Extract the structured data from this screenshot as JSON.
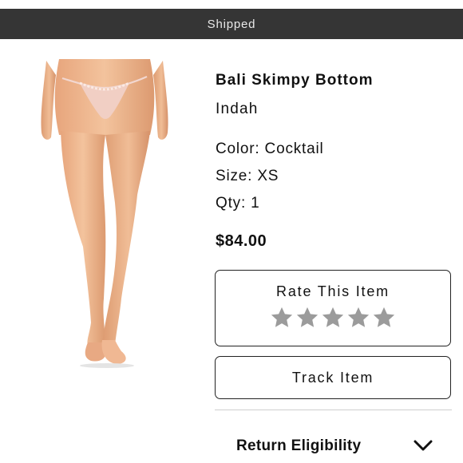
{
  "status_bar": {
    "label": "Shipped"
  },
  "product": {
    "name": "Bali Skimpy Bottom",
    "brand": "Indah",
    "color": "Color: Cocktail",
    "size": "Size: XS",
    "quantity": "Qty: 1",
    "price": "$84.00",
    "image_icon": "product-photo"
  },
  "rating": {
    "title": "Rate This Item",
    "star_count": 5,
    "selected": 0,
    "star_icon": "star-icon",
    "star_color": "#9b9b9b"
  },
  "actions": {
    "track_label": "Track Item"
  },
  "return_section": {
    "label": "Return Eligibility",
    "icon": "chevron-down-icon",
    "expanded": false
  },
  "colors": {
    "status_bar_bg": "#353535",
    "status_bar_text": "#e9e9e9",
    "text": "#111111",
    "border": "#222222",
    "divider": "#cfcfcf"
  }
}
